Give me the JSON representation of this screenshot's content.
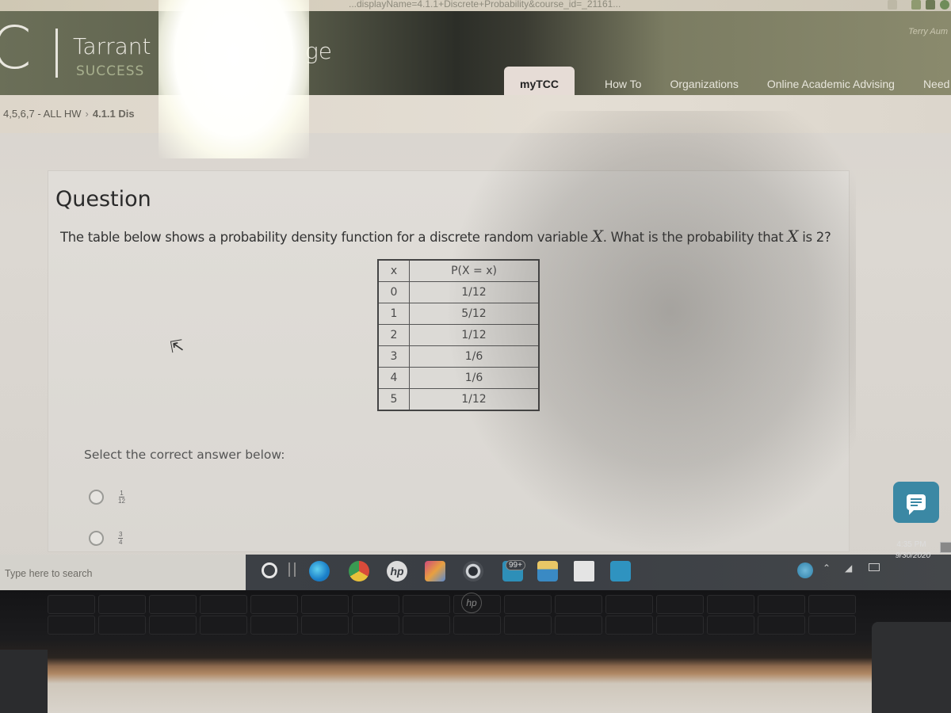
{
  "browser": {
    "url_fragment": "...displayName=4.1.1+Discrete+Probability&course_id=_21161..."
  },
  "site": {
    "logo_letter": "C",
    "name_start": "Tarrant",
    "name_end": "ge",
    "tagline": "SUCCESS",
    "user_name": "Terry Aum",
    "nav": [
      {
        "label": "myTCC",
        "active": true
      },
      {
        "label": "How To",
        "active": false
      },
      {
        "label": "Organizations",
        "active": false
      },
      {
        "label": "Online Academic Advising",
        "active": false
      },
      {
        "label": "Need",
        "active": false
      }
    ]
  },
  "breadcrumb": {
    "parent": "4,5,6,7 - ALL HW",
    "separator": "›",
    "current": "4.1.1 Dis"
  },
  "question": {
    "heading": "Question",
    "text_before": "The table below shows a probability density function for a discrete random variable ",
    "variable": "X",
    "text_middle": ". What is the probability that ",
    "text_after": " is 2?",
    "table": {
      "headers": [
        "x",
        "P(X = x)"
      ],
      "rows": [
        [
          "0",
          "1/12"
        ],
        [
          "1",
          "5/12"
        ],
        [
          "2",
          "1/12"
        ],
        [
          "3",
          "1/6"
        ],
        [
          "4",
          "1/6"
        ],
        [
          "5",
          "1/12"
        ]
      ]
    },
    "select_prompt": "Select the correct answer below:",
    "options": [
      {
        "numerator": "1",
        "denominator": "12",
        "selected": false
      },
      {
        "numerator": "3",
        "denominator": "4",
        "selected": false
      }
    ]
  },
  "chat_widget": {
    "icon": "chat-icon"
  },
  "taskbar": {
    "search_placeholder": "Type here to search",
    "mail_badge": "99+",
    "time": "4:35 PM",
    "date": "9/30/2020",
    "apps": [
      "cortana",
      "task-view",
      "edge",
      "chrome",
      "hp",
      "photos",
      "camera",
      "mail",
      "file-explorer",
      "store",
      "weather"
    ]
  },
  "laptop": {
    "brand": "hp"
  }
}
